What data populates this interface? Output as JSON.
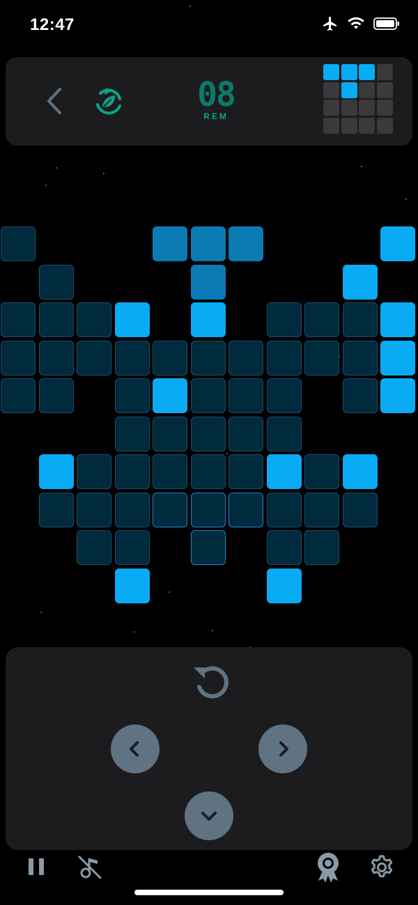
{
  "status_bar": {
    "time": "12:47",
    "icons": [
      "airplane-icon",
      "wifi-icon",
      "battery-icon"
    ]
  },
  "header": {
    "back_icon": "chevron-left-icon",
    "leaf_icon": "leaf-refresh-icon",
    "counter_value": "08",
    "counter_label": "REM"
  },
  "next_piece_preview": {
    "rows": 4,
    "cols": 4,
    "filled": [
      [
        0,
        0
      ],
      [
        0,
        1
      ],
      [
        0,
        2
      ],
      [
        1,
        1
      ]
    ]
  },
  "board": {
    "cols": 11,
    "rows": 10,
    "cells": [
      [
        0,
        0,
        "empty"
      ],
      [
        0,
        4,
        "active"
      ],
      [
        0,
        5,
        "active"
      ],
      [
        0,
        6,
        "active"
      ],
      [
        0,
        10,
        "filled"
      ],
      [
        1,
        1,
        "empty"
      ],
      [
        1,
        5,
        "active"
      ],
      [
        1,
        9,
        "filled"
      ],
      [
        2,
        0,
        "empty"
      ],
      [
        2,
        1,
        "empty"
      ],
      [
        2,
        2,
        "empty"
      ],
      [
        2,
        3,
        "filled"
      ],
      [
        2,
        5,
        "filled"
      ],
      [
        2,
        7,
        "empty"
      ],
      [
        2,
        8,
        "empty"
      ],
      [
        2,
        9,
        "empty"
      ],
      [
        2,
        10,
        "filled"
      ],
      [
        3,
        0,
        "empty"
      ],
      [
        3,
        1,
        "empty"
      ],
      [
        3,
        2,
        "empty"
      ],
      [
        3,
        3,
        "empty"
      ],
      [
        3,
        4,
        "empty"
      ],
      [
        3,
        5,
        "empty"
      ],
      [
        3,
        6,
        "empty"
      ],
      [
        3,
        7,
        "empty"
      ],
      [
        3,
        8,
        "empty"
      ],
      [
        3,
        9,
        "empty"
      ],
      [
        3,
        10,
        "filled"
      ],
      [
        4,
        0,
        "empty"
      ],
      [
        4,
        1,
        "empty"
      ],
      [
        4,
        3,
        "empty"
      ],
      [
        4,
        4,
        "filled"
      ],
      [
        4,
        5,
        "empty"
      ],
      [
        4,
        6,
        "empty"
      ],
      [
        4,
        7,
        "empty"
      ],
      [
        4,
        9,
        "empty"
      ],
      [
        4,
        10,
        "filled"
      ],
      [
        5,
        3,
        "empty"
      ],
      [
        5,
        4,
        "empty"
      ],
      [
        5,
        5,
        "empty"
      ],
      [
        5,
        6,
        "empty"
      ],
      [
        5,
        7,
        "empty"
      ],
      [
        6,
        1,
        "filled"
      ],
      [
        6,
        2,
        "empty"
      ],
      [
        6,
        3,
        "empty"
      ],
      [
        6,
        4,
        "empty"
      ],
      [
        6,
        5,
        "empty"
      ],
      [
        6,
        6,
        "empty"
      ],
      [
        6,
        7,
        "filled"
      ],
      [
        6,
        8,
        "empty"
      ],
      [
        6,
        9,
        "filled"
      ],
      [
        7,
        1,
        "empty"
      ],
      [
        7,
        2,
        "empty"
      ],
      [
        7,
        3,
        "empty"
      ],
      [
        7,
        4,
        "ghost"
      ],
      [
        7,
        5,
        "ghost"
      ],
      [
        7,
        6,
        "ghost"
      ],
      [
        7,
        7,
        "empty"
      ],
      [
        7,
        8,
        "empty"
      ],
      [
        7,
        9,
        "empty"
      ],
      [
        8,
        2,
        "empty"
      ],
      [
        8,
        3,
        "empty"
      ],
      [
        8,
        5,
        "ghost"
      ],
      [
        8,
        7,
        "empty"
      ],
      [
        8,
        8,
        "empty"
      ],
      [
        9,
        3,
        "filled"
      ],
      [
        9,
        7,
        "filled"
      ]
    ]
  },
  "controls": {
    "rotate_icon": "rotate-ccw-icon",
    "left_icon": "chevron-left-icon",
    "right_icon": "chevron-right-icon",
    "down_icon": "chevron-down-icon"
  },
  "bottom_bar": {
    "pause_icon": "pause-icon",
    "music_off_icon": "music-off-icon",
    "award_icon": "award-icon",
    "settings_icon": "gear-icon"
  },
  "colors": {
    "filled": "#0aabf5",
    "active": "#0a7bb5",
    "empty": "#002a3d",
    "empty_border": "#1f4d66",
    "ghost_border": "#1a8ad0",
    "panel": "#1c1c1e",
    "control": "#5f7382"
  }
}
